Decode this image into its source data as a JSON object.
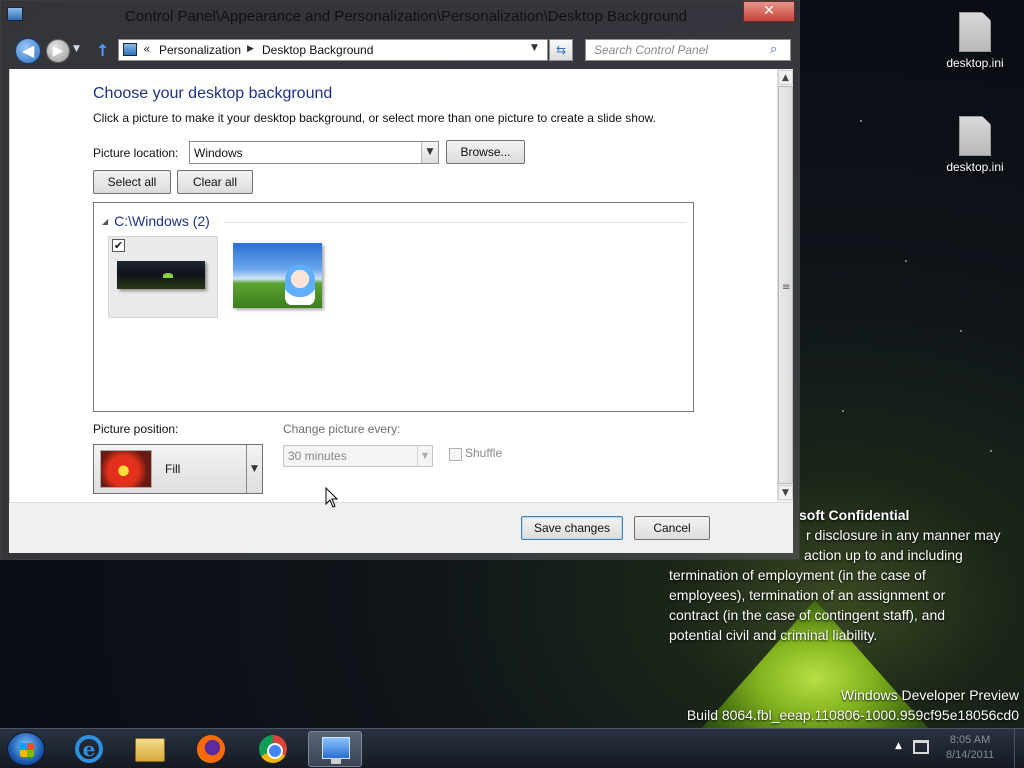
{
  "window": {
    "title": "Control Panel\\Appearance and Personalization\\Personalization\\Desktop Background",
    "close_label": "✕"
  },
  "navigation": {
    "breadcrumbs": [
      "Personalization",
      "Desktop Background"
    ],
    "search_placeholder": "Search Control Panel"
  },
  "content": {
    "heading": "Choose your desktop background",
    "instructions": "Click a picture to make it your desktop background, or select more than one picture to create a slide show.",
    "picture_location_label": "Picture location:",
    "picture_location_value": "Windows",
    "browse_label": "Browse...",
    "select_all_label": "Select all",
    "clear_all_label": "Clear all",
    "group_header": "C:\\Windows (2)",
    "pictures": [
      {
        "name": "night-tent-wallpaper",
        "checked": true,
        "checkmark": "✔"
      },
      {
        "name": "bliss-anime-wallpaper",
        "checked": false
      }
    ],
    "picture_position_label": "Picture position:",
    "picture_position_value": "Fill",
    "change_every_label": "Change picture every:",
    "change_every_value": "30 minutes",
    "shuffle_label": "Shuffle",
    "save_label": "Save changes",
    "cancel_label": "Cancel"
  },
  "desktop": {
    "icons": [
      {
        "label": "desktop.ini"
      },
      {
        "label": "desktop.ini"
      }
    ],
    "confidential_title": "soft Confidential",
    "confidential_lines": [
      "r disclosure in any manner may",
      "action up to and including",
      "termination of employment (in the case of",
      "employees), termination of an assignment or",
      "contract (in the case of contingent staff), and",
      "potential civil and criminal liability."
    ],
    "build_line1": "Windows Developer Preview",
    "build_line2": "Build 8064.fbl_eeap.110806-1000.959cf95e18056cd0"
  },
  "taskbar": {
    "apps": [
      "internet-explorer",
      "windows-explorer",
      "firefox",
      "chrome",
      "control-panel"
    ],
    "active_app": "control-panel",
    "clock_time": "8:05 AM",
    "clock_date": "8/14/2011"
  },
  "colors": {
    "heading": "#1e3287",
    "close_button": "#c7443a",
    "taskbar": "#151a22"
  }
}
